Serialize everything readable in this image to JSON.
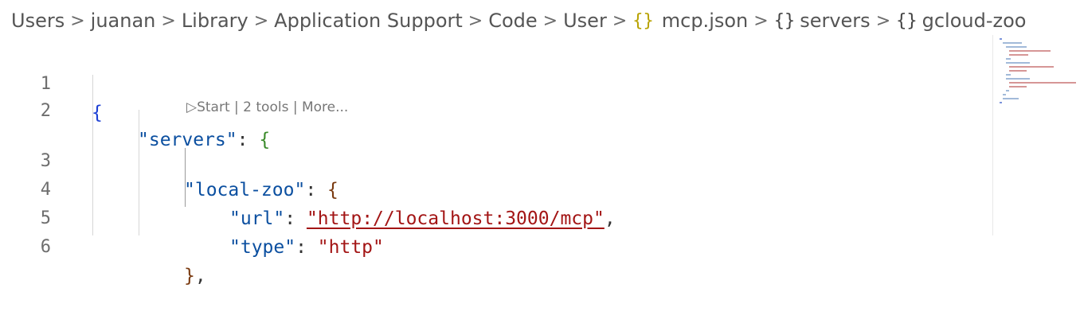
{
  "breadcrumb": {
    "items": [
      "Users",
      "juanan",
      "Library",
      "Application Support",
      "Code",
      "User"
    ],
    "file_icon": "{}",
    "file_name": "mcp.json",
    "servers_icon": "{}",
    "servers_label": "servers",
    "gcloud_icon": "{}",
    "gcloud_label": "gcloud-zoo",
    "separator": ">"
  },
  "editor": {
    "line_numbers": [
      "1",
      "2",
      "3",
      "4",
      "5",
      "6"
    ],
    "codelens": {
      "start": "Start",
      "tools": "2 tools",
      "more": "More...",
      "divider": "|"
    },
    "lines": {
      "l1_brace": "{",
      "l2_key": "\"servers\"",
      "l2_colon": ": ",
      "l2_brace": "{",
      "l3_key": "\"local-zoo\"",
      "l3_colon": ": ",
      "l3_brace": "{",
      "l4_key": "\"url\"",
      "l4_colon": ": ",
      "l4_value": "\"http://localhost:3000/mcp\"",
      "l4_comma": ",",
      "l5_key": "\"type\"",
      "l5_colon": ": ",
      "l5_value": "\"http\"",
      "l6_brace": "}",
      "l6_comma": ","
    }
  },
  "colors": {
    "key": "#0b4fa0",
    "string": "#a31515",
    "json_icon": "#b8a200"
  }
}
